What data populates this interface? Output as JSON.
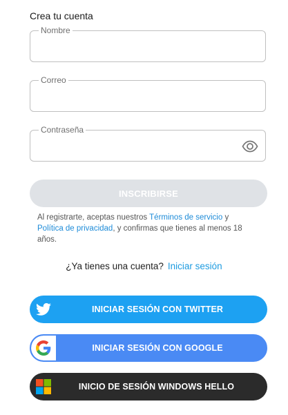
{
  "form": {
    "title": "Crea tu cuenta",
    "fields": {
      "name": {
        "label": "Nombre",
        "value": ""
      },
      "email": {
        "label": "Correo",
        "value": ""
      },
      "password": {
        "label": "Contraseña",
        "value": ""
      }
    },
    "signup_label": "INSCRIBIRSE",
    "legal": {
      "prefix": "Al registrarte, aceptas nuestros ",
      "terms_link": "Términos de servicio",
      "middle": " y ",
      "privacy_link": "Política de privacidad",
      "suffix": ", y confirmas que tienes al menos 18 años."
    },
    "have_account": {
      "question": "¿Ya tienes una cuenta?",
      "login_link": "Iniciar sesión"
    }
  },
  "social": {
    "twitter": {
      "label": "INICIAR SESIÓN CON TWITTER",
      "icon": "twitter-bird-icon"
    },
    "google": {
      "label": "INICIAR SESIÓN CON GOOGLE",
      "icon": "google-g-icon"
    },
    "windows": {
      "label": "INICIO DE SESIÓN WINDOWS HELLO",
      "icon": "windows-logo-icon"
    }
  },
  "colors": {
    "twitter": "#1da1f2",
    "google": "#4a8af4",
    "windows": "#2b2b2b",
    "link": "#1d9be0",
    "disabled_button": "#dfe2e6"
  }
}
